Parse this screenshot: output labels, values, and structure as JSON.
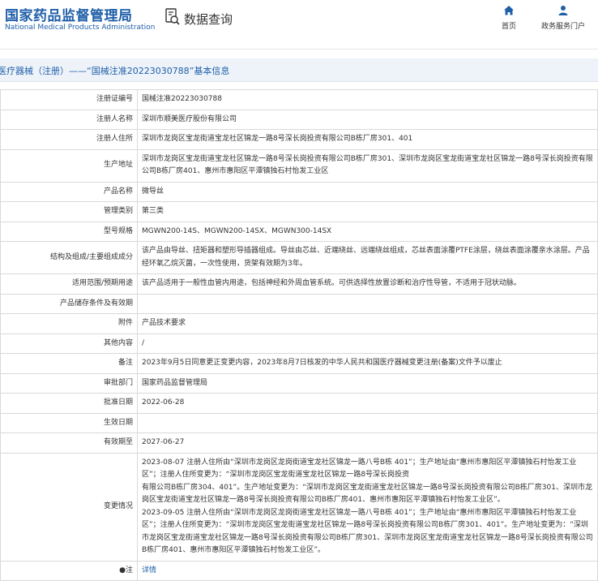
{
  "header": {
    "logo_cn": "国家药品监督管理局",
    "logo_en": "National Medical Products Administration",
    "query_label": "数据查询",
    "nav": [
      {
        "label": "首页",
        "icon": "home-icon"
      },
      {
        "label": "政务服务门户",
        "icon": "user-icon"
      }
    ]
  },
  "title_bar": "医疗器械（注册）——“国械注准20223030788”基本信息",
  "rows": [
    {
      "label": "注册证编号",
      "value": "国械注准20223030788"
    },
    {
      "label": "注册人名称",
      "value": "深圳市顺美医疗股份有限公司"
    },
    {
      "label": "注册人住所",
      "value": "深圳市龙岗区宝龙街道宝龙社区锦龙一路8号深长岗投资有限公司B栋厂房301、401"
    },
    {
      "label": "生产地址",
      "value": "深圳市龙岗区宝龙街道宝龙社区锦龙一路8号深长岗投资有限公司B栋厂房301、深圳市龙岗区宝龙街道宝龙社区锦龙一路8号深长岗投资有限公司B栋厂房401、惠州市惠阳区平潭镇独石村怡发工业区"
    },
    {
      "label": "产品名称",
      "value": "微导丝"
    },
    {
      "label": "管理类别",
      "value": "第三类"
    },
    {
      "label": "型号规格",
      "value": "MGWN200-14S、MGWN200-14SX、MGWN300-14SX"
    },
    {
      "label": "结构及组成/主要组成成分",
      "value": "该产品由导丝、扭矩器和塑形导插器组成。导丝由芯丝、近端绕丝、远端绕丝组成，芯丝表面涂覆PTFE涂层，绕丝表面涂覆亲水涂层。产品经环氧乙烷灭菌，一次性使用，货架有效期为3年。"
    },
    {
      "label": "适用范围/预期用途",
      "value": "该产品适用于一般性血管内用途，包括神经和外周血管系统。可供选择性放置诊断和治疗性导管，不适用于冠状动脉。"
    },
    {
      "label": "产品储存条件及有效期",
      "value": ""
    },
    {
      "label": "附件",
      "value": "产品技术要求"
    },
    {
      "label": "其他内容",
      "value": "/"
    },
    {
      "label": "备注",
      "value": "2023年9月5日同意更正变更内容，2023年8月7日核发的中华人民共和国医疗器械变更注册(备案)文件予以废止"
    },
    {
      "label": "审批部门",
      "value": "国家药品监督管理局"
    },
    {
      "label": "批准日期",
      "value": "2022-06-28"
    },
    {
      "label": "生效日期",
      "value": ""
    },
    {
      "label": "有效期至",
      "value": "2027-06-27"
    }
  ],
  "change": {
    "label": "变更情况",
    "lines": [
      "2023-08-07 注册人住所由“深圳市龙岗区龙岗街道宝龙社区锦龙一路八号B栋 401”；生产地址由“惠州市惠阳区平潭镇独石村怡发工业区”；注册人住所变更为：“深圳市龙岗区宝龙街道宝龙社区锦龙一路8号深长岗投资",
      "有限公司B栋厂房304、401”。生产地址变更为：“深圳市龙岗区宝龙街道宝龙社区锦龙一路8号深长岗投资有限公司B栋厂房301、深圳市龙岗区宝龙街道宝龙社区锦龙一路8号深长岗投资有限公司B栋厂房401、惠州市惠阳区平潭镇独石村怡发工业区”。",
      "2023-09-05 注册人住所由“深圳市龙岗区龙岗街道宝龙社区锦龙一路八号B栋 401”；生产地址由“惠州市惠阳区平潭镇独石村怡发工业区”；注册人住所变更为：“深圳市龙岗区宝龙街道宝龙社区锦龙一路8号深长岗投资有限公司B栋厂房301、401”。生产地址变更为：“深圳市龙岗区宝龙街道宝龙社区锦龙一路8号深长岗投资有限公司B栋厂房301、深圳市龙岗区宝龙街道宝龙社区锦龙一路8号深长岗投资有限公司B栋厂房401、惠州市惠阳区平潭镇独石村怡发工业区”。"
    ]
  },
  "note": {
    "label": "注",
    "link": "详情"
  },
  "colors": {
    "brand": "#1f5fa8",
    "bar_bg": "#eef3f9",
    "border": "#d9d9d9"
  }
}
